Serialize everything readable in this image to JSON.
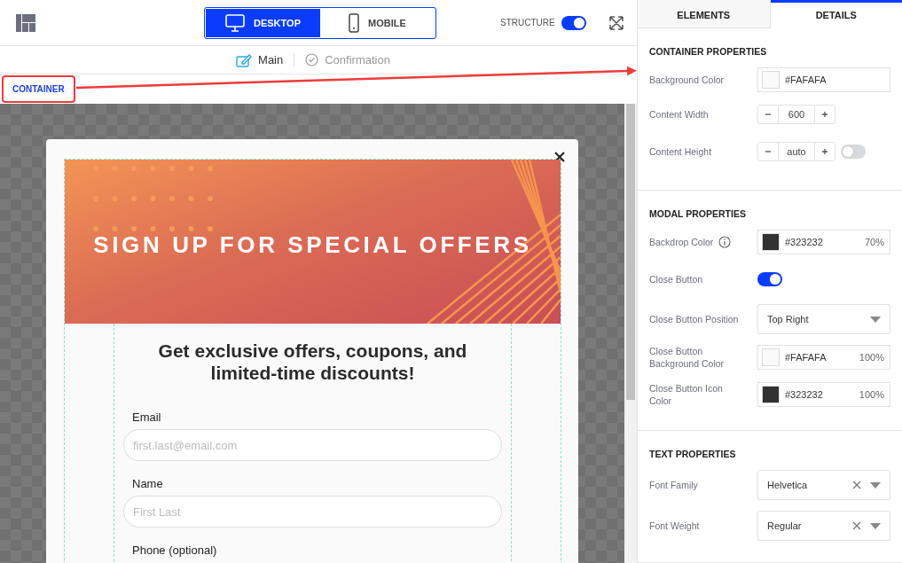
{
  "toolbar": {
    "view_modes": [
      {
        "label": "DESKTOP",
        "kind": "desktop",
        "selected": true
      },
      {
        "label": "MOBILE",
        "kind": "mobile",
        "selected": false
      }
    ],
    "structure": {
      "label": "STRUCTURE",
      "on": true
    }
  },
  "pages": [
    {
      "label": "Main",
      "kind": "edit",
      "selected": true
    },
    {
      "label": "Confirmation",
      "kind": "check",
      "selected": false
    }
  ],
  "breadcrumb": {
    "label": "CONTAINER"
  },
  "modal": {
    "banner_title": "SIGN UP FOR SPECIAL OFFERS",
    "heading": "Get exclusive offers, coupons, and limited-time discounts!",
    "fields": [
      {
        "label": "Email",
        "placeholder": "first.last@email.com"
      },
      {
        "label": "Name",
        "placeholder": "First Last"
      },
      {
        "label": "Phone (optional)"
      }
    ]
  },
  "panel": {
    "tabs": [
      {
        "label": "ELEMENTS",
        "selected": false
      },
      {
        "label": "DETAILS",
        "selected": true
      }
    ],
    "sections": [
      {
        "title": "CONTAINER PROPERTIES",
        "rows": [
          {
            "kind": "color",
            "label": "Background Color",
            "color": "#fafafa",
            "value": "#FAFAFA"
          },
          {
            "kind": "stepper",
            "label": "Content Width",
            "value": "600"
          },
          {
            "kind": "stepper",
            "label": "Content Height",
            "value": "auto",
            "on": false
          }
        ]
      },
      {
        "title": "MODAL PROPERTIES",
        "rows": [
          {
            "kind": "color",
            "label": "Backdrop Color",
            "hint": true,
            "color": "#323232",
            "value": "#323232",
            "opacity": "70%"
          },
          {
            "kind": "toggle",
            "label": "Close Button",
            "on": true
          },
          {
            "kind": "select",
            "label": "Close Button Position",
            "value": "Top Right"
          },
          {
            "kind": "color",
            "label": "Close Button Background Color",
            "color": "#fafafa",
            "value": "#FAFAFA",
            "opacity": "100%"
          },
          {
            "kind": "color",
            "label": "Close Button Icon Color",
            "color": "#323232",
            "value": "#323232",
            "opacity": "100%"
          }
        ]
      },
      {
        "title": "TEXT PROPERTIES",
        "rows": [
          {
            "kind": "select",
            "label": "Font Family",
            "value": "Helvetica",
            "clearable": true
          },
          {
            "kind": "select",
            "label": "Font Weight",
            "value": "Regular",
            "clearable": true
          }
        ]
      }
    ]
  }
}
